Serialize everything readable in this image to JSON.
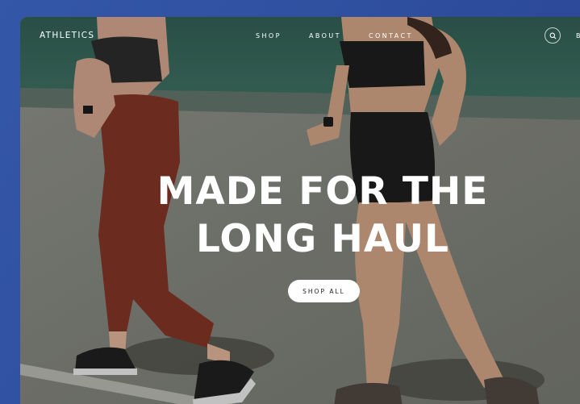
{
  "brand": {
    "name": "ATHLETICS"
  },
  "nav": {
    "items": [
      {
        "label": "SHOP"
      },
      {
        "label": "ABOUT"
      },
      {
        "label": "CONTACT"
      }
    ],
    "search_icon": "search-icon",
    "cut_off_label": "B"
  },
  "hero": {
    "heading_line1": "MADE FOR THE",
    "heading_line2": "LONG HAUL",
    "cta_label": "SHOP ALL",
    "image_alt": "Two women running on a track"
  },
  "colors": {
    "outer_background": "#3254a6",
    "track_green": "#2f5a4f",
    "track_grey": "#7a7a72",
    "text": "#ffffff",
    "button_bg": "#ffffff",
    "button_text": "#222222"
  }
}
